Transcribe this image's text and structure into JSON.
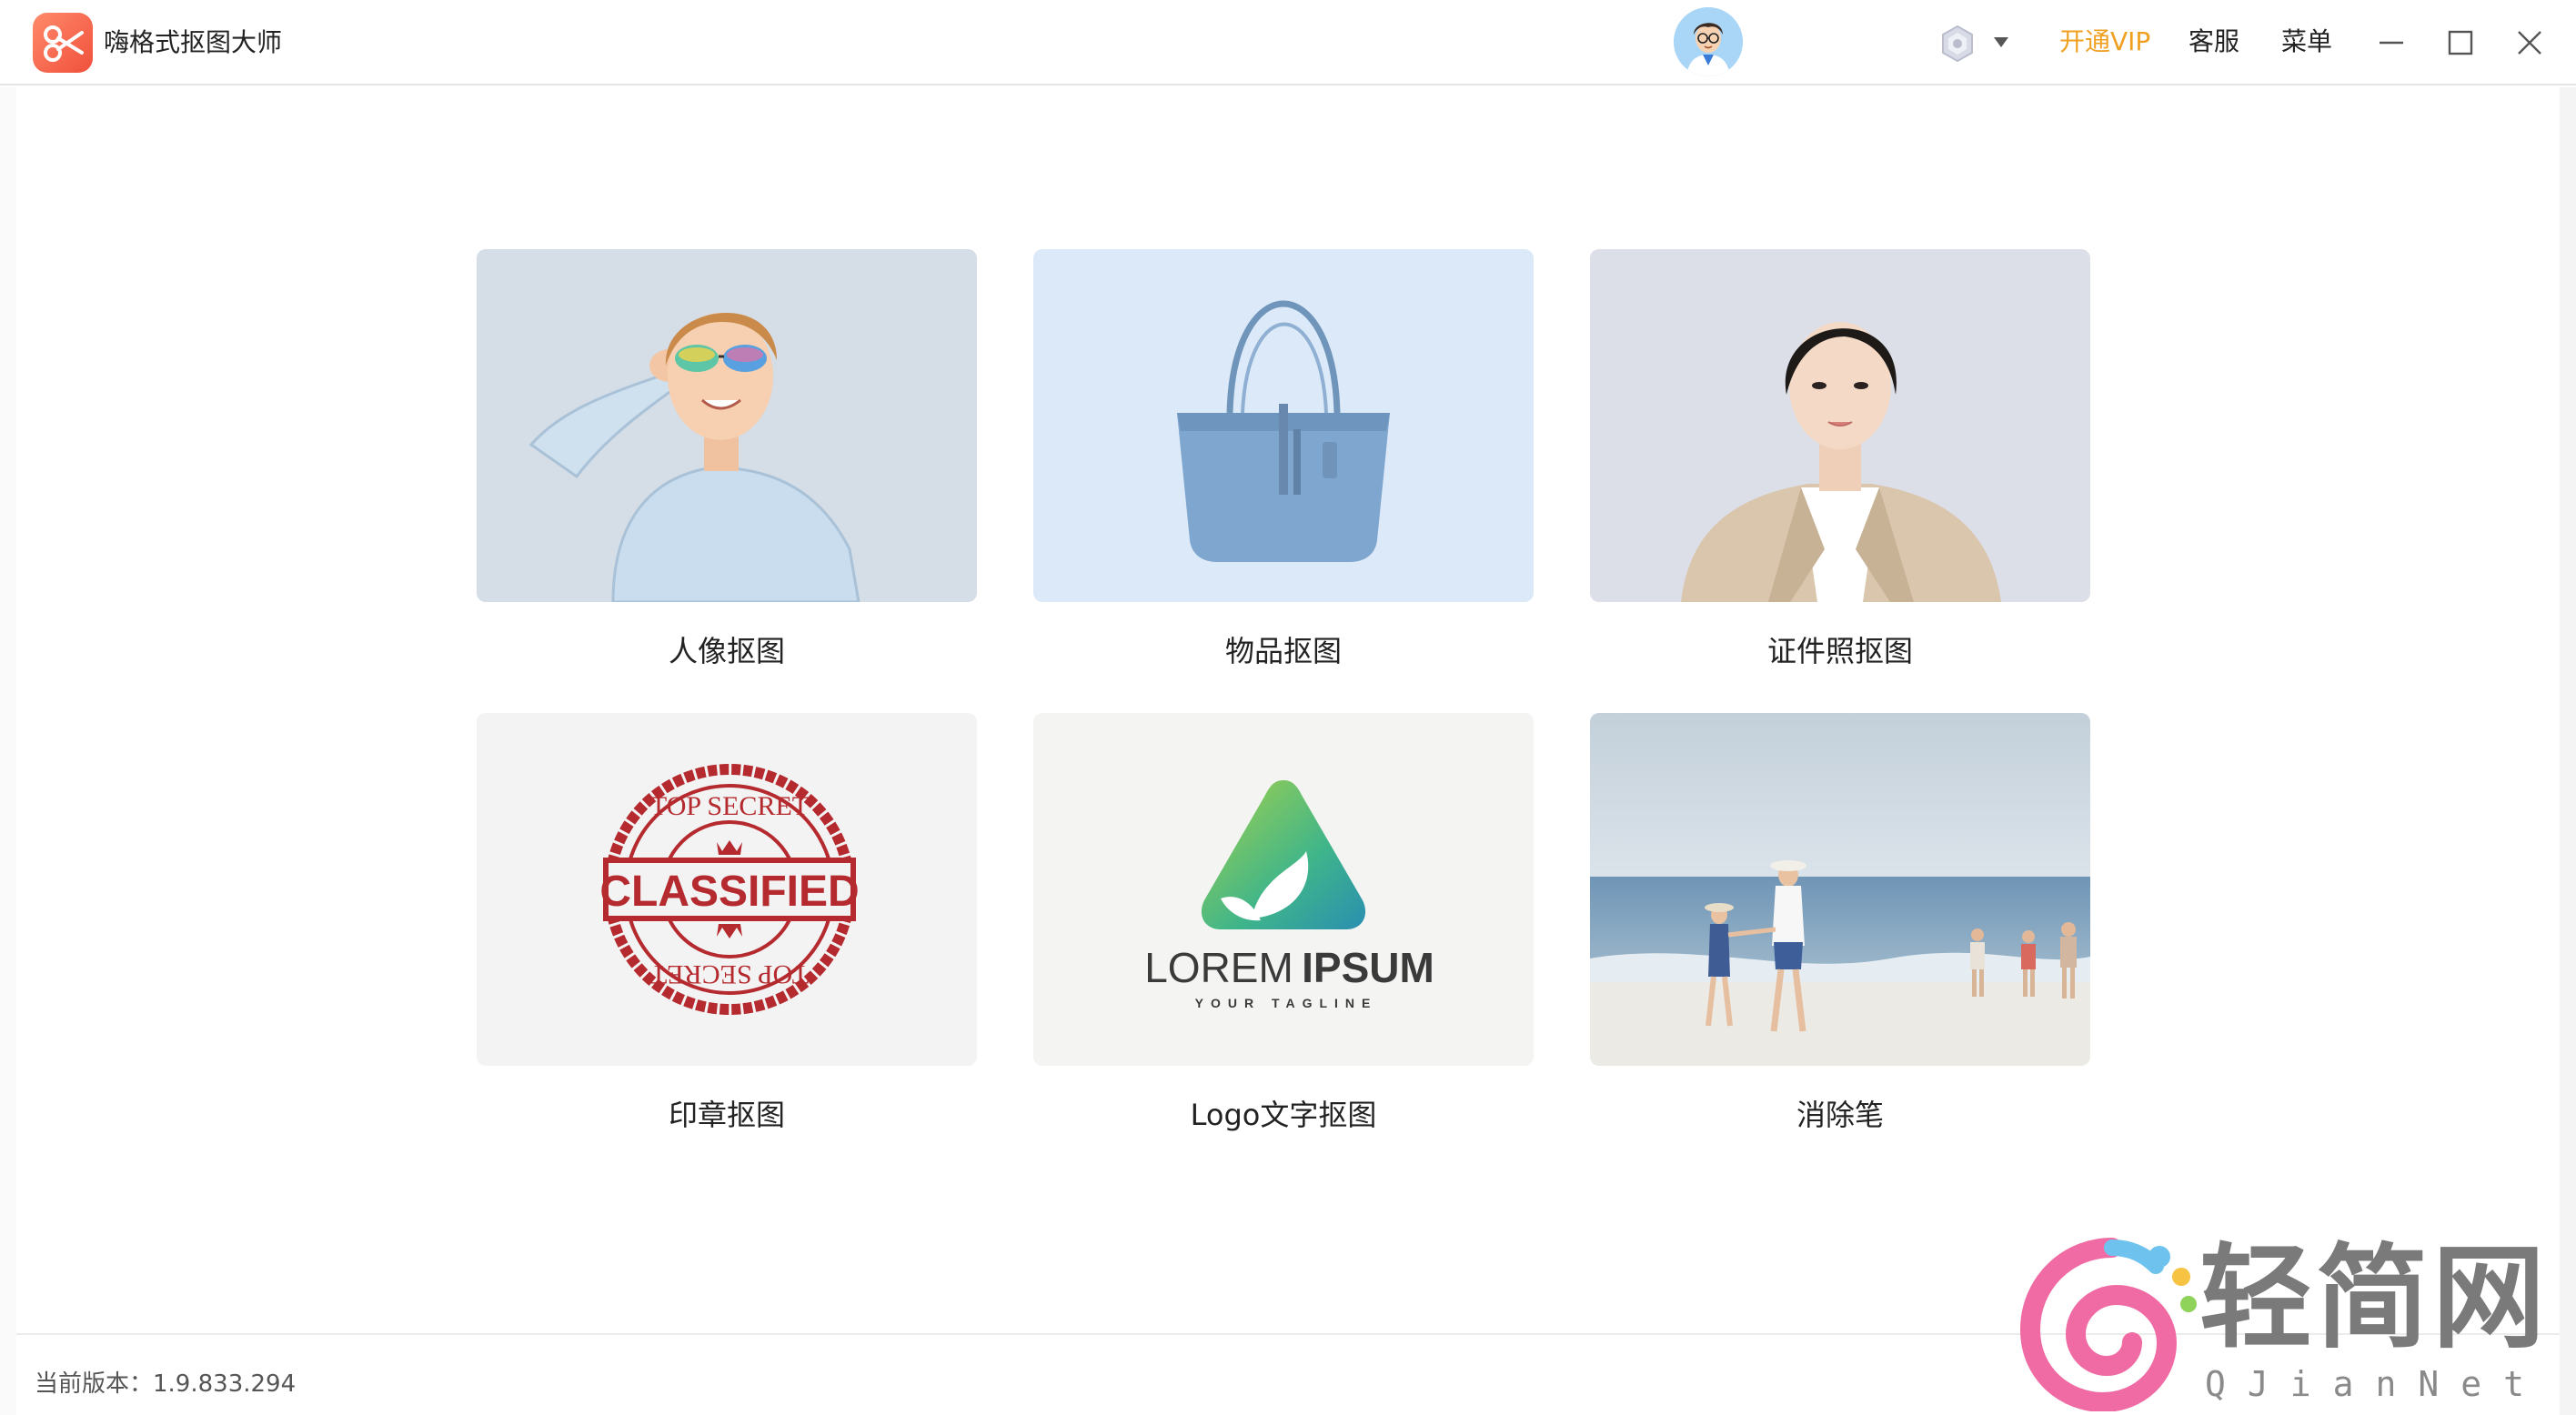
{
  "window": {
    "title": "嗨格式抠图大师",
    "vip_label": "开通VIP",
    "service_label": "客服",
    "menu_label": "菜单"
  },
  "icons": {
    "app_logo": "scissors-logo-icon",
    "avatar": "user-avatar-icon",
    "settings": "settings-badge-icon",
    "dropdown": "caret-down-icon",
    "minimize": "minimize-icon",
    "maximize": "maximize-icon",
    "close": "close-icon"
  },
  "colors": {
    "vip": "#f0a020",
    "logo_accent": "#f0503b"
  },
  "features": [
    {
      "label": "人像抠图",
      "thumb": "portrait-kid-sunglasses"
    },
    {
      "label": "物品抠图",
      "thumb": "blue-tote-bag"
    },
    {
      "label": "证件照抠图",
      "thumb": "id-photo-woman"
    },
    {
      "label": "印章抠图",
      "thumb": "classified-stamp"
    },
    {
      "label": "Logo文字抠图",
      "thumb": "lorem-ipsum-logo"
    },
    {
      "label": "消除笔",
      "thumb": "beach-scene"
    }
  ],
  "thumb_text": {
    "stamp_top": "TOP SECRET",
    "stamp_main": "CLASSIFIED",
    "stamp_bottom": "TOP SECRET",
    "logo_word_1": "LOREM",
    "logo_word_2": "IPSUM",
    "logo_tagline": "YOUR TAGLINE"
  },
  "footer": {
    "version": "当前版本：1.9.833.294"
  },
  "watermark": {
    "cn": "轻简网",
    "en": "QJianNet"
  }
}
